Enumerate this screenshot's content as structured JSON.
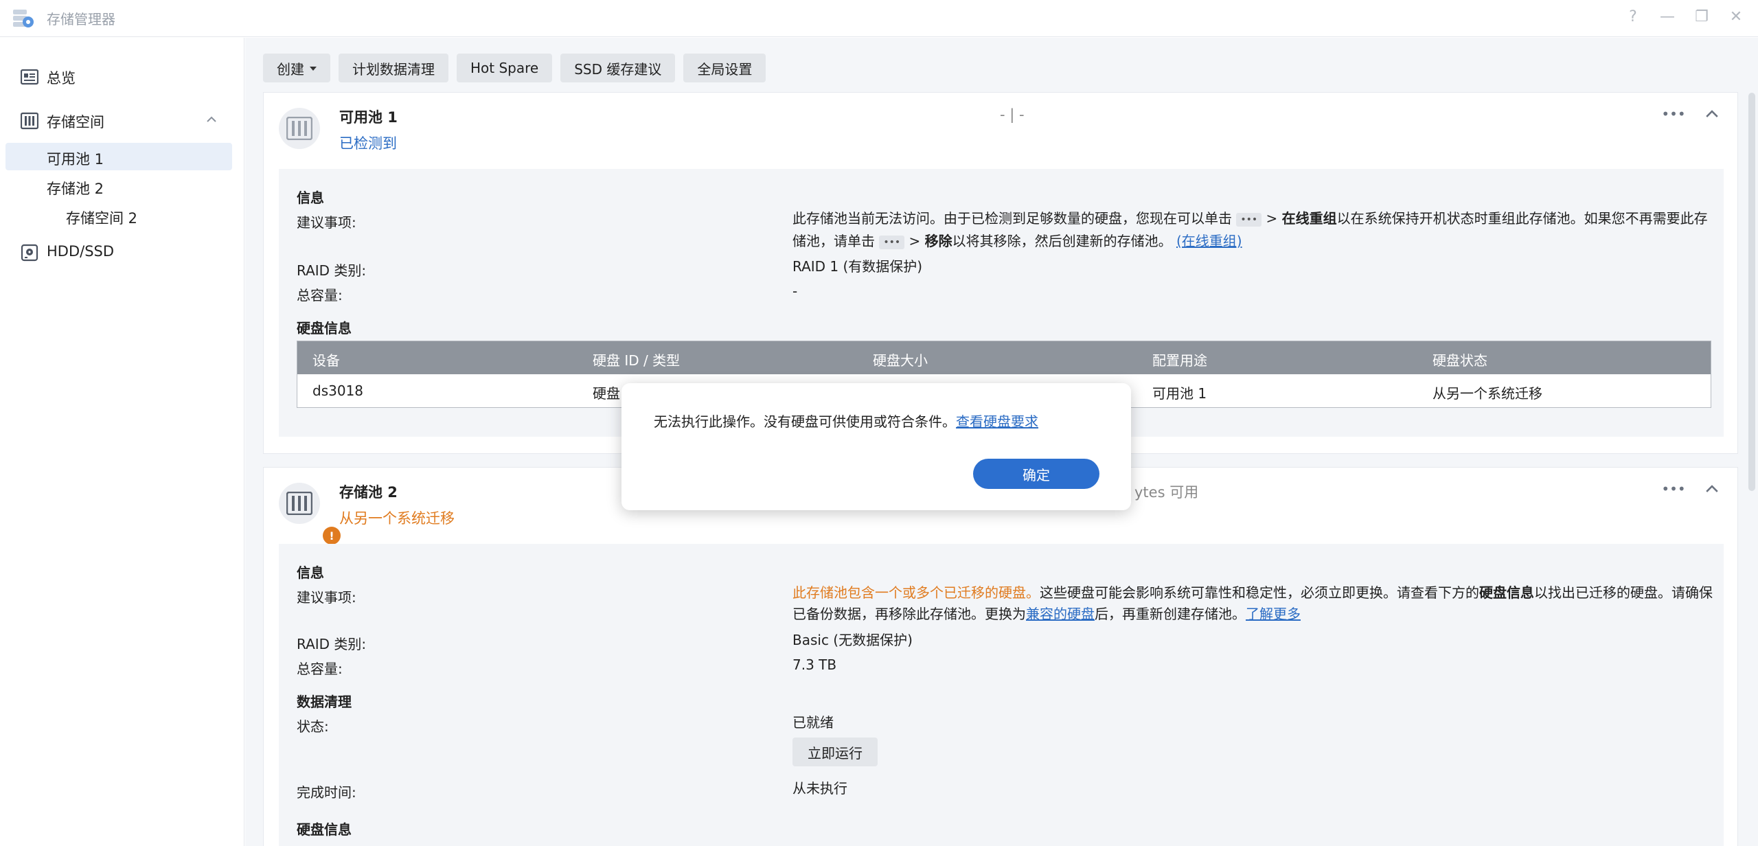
{
  "window": {
    "title": "存储管理器",
    "controls": [
      "help-icon",
      "minimize-icon",
      "maximize-icon",
      "close-icon"
    ],
    "help_glyph": "?",
    "minimize_glyph": "—",
    "maximize_glyph": "❐",
    "close_glyph": "✕"
  },
  "sidebar": {
    "overview": "总览",
    "storage": "存储空间",
    "pool1": "可用池 1",
    "pool2": "存储池 2",
    "volume2": "存储空间 2",
    "hdd": "HDD/SSD"
  },
  "toolbar": {
    "create": "创建",
    "scrub": "计划数据清理",
    "hot_spare": "Hot Spare",
    "ssd": "SSD 缓存建议",
    "global": "全局设置"
  },
  "pool1": {
    "title": "可用池 1",
    "status": "已检测到",
    "center": "- | -",
    "info_title": "信息",
    "suggest_label": "建议事项:",
    "suggest_p1": "此存储池当前无法访问。由于已检测到足够数量的硬盘，您现在可以单击",
    "suggest_dots1": "•••",
    "suggest_gt1": ">",
    "suggest_b1": "在线重组",
    "suggest_p2": "以在系统保持开机状态时重组此存储池。如果您不再需要此存储池，请单击",
    "suggest_dots2": "•••",
    "suggest_gt2": ">",
    "suggest_b2": "移除",
    "suggest_p3": "以将其移除，然后创建新的存储池。",
    "suggest_link": "(在线重组)",
    "raid_label": "RAID 类别:",
    "raid_value": "RAID 1 (有数据保护)",
    "cap_label": "总容量:",
    "cap_value": "-",
    "disk_title": "硬盘信息",
    "table": {
      "headers": [
        "设备",
        "硬盘 ID / 类型",
        "硬盘大小",
        "配置用途",
        "硬盘状态"
      ],
      "row": {
        "device": "ds3018",
        "id_type": "硬盘",
        "usage": "可用池 1",
        "status": "从另一个系统迁移"
      }
    }
  },
  "pool2": {
    "title": "存储池 2",
    "status": "从另一个系统迁移",
    "center": "ytes 可用",
    "info_title": "信息",
    "suggest_label": "建议事项:",
    "suggest_orange": "此存储池包含一个或多个已迁移的硬盘。",
    "suggest_p1": "这些硬盘可能会影响系统可靠性和稳定性，必须立即更换。请查看下方的",
    "suggest_b1": "硬盘信息",
    "suggest_p2": "以找出已迁移的硬盘。请确保已备份数据，再移除此存储池。更换为",
    "suggest_link1": "兼容的硬盘",
    "suggest_p3": "后，再重新创建存储池。",
    "suggest_link2": "了解更多",
    "raid_label": "RAID 类别:",
    "raid_value": "Basic (无数据保护)",
    "cap_label": "总容量:",
    "cap_value": "7.3 TB",
    "scrub_title": "数据清理",
    "state_label": "状态:",
    "state_value": "已就绪",
    "run_button": "立即运行",
    "done_label": "完成时间:",
    "done_value": "从未执行",
    "disk_title": "硬盘信息"
  },
  "dialog": {
    "message": "无法执行此操作。没有硬盘可供使用或符合条件。",
    "link": "查看硬盘要求",
    "ok": "确定"
  },
  "colors": {
    "accent": "#2c6fcf",
    "warning": "#e07b1f",
    "danger": "#cc3a3a",
    "link": "#2b6cc4"
  }
}
